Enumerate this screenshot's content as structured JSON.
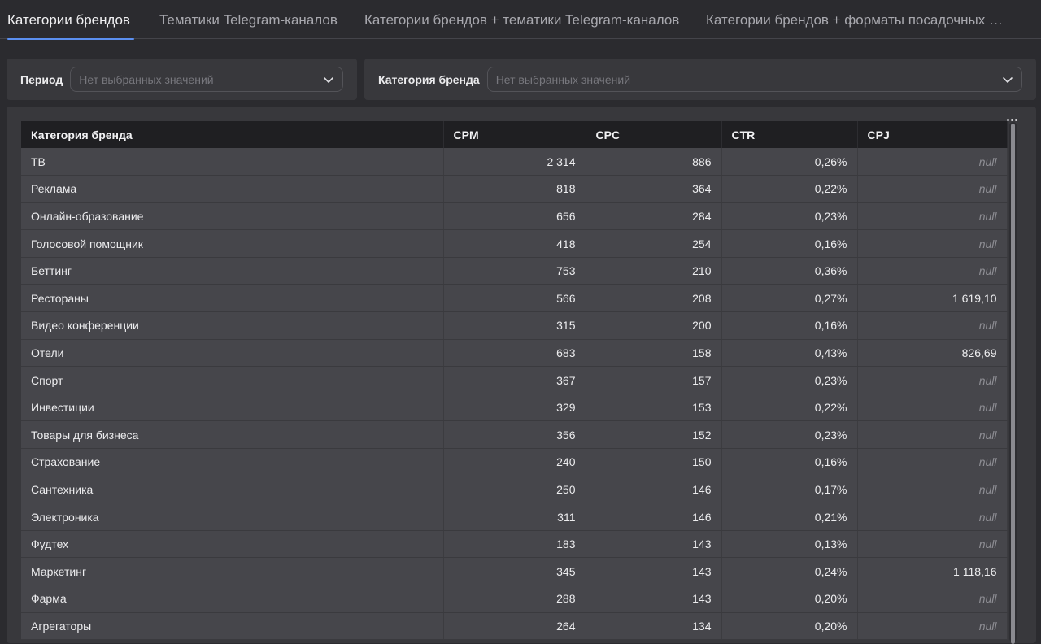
{
  "tabs": [
    {
      "label": "Категории брендов",
      "active": true
    },
    {
      "label": "Тематики Telegram-каналов",
      "active": false
    },
    {
      "label": "Категории брендов + тематики Telegram-каналов",
      "active": false
    },
    {
      "label": "Категории брендов + форматы посадочных с...",
      "active": false
    }
  ],
  "filters": {
    "period": {
      "label": "Период",
      "placeholder": "Нет выбранных значений"
    },
    "category": {
      "label": "Категория бренда",
      "placeholder": "Нет выбранных значений"
    }
  },
  "table": {
    "headers": [
      "Категория бренда",
      "CPM",
      "CPC",
      "CTR",
      "CPJ"
    ],
    "rows": [
      [
        "ТВ",
        "2 314",
        "886",
        "0,26%",
        "null"
      ],
      [
        "Реклама",
        "818",
        "364",
        "0,22%",
        "null"
      ],
      [
        "Онлайн-образование",
        "656",
        "284",
        "0,23%",
        "null"
      ],
      [
        "Голосовой помощник",
        "418",
        "254",
        "0,16%",
        "null"
      ],
      [
        "Беттинг",
        "753",
        "210",
        "0,36%",
        "null"
      ],
      [
        "Рестораны",
        "566",
        "208",
        "0,27%",
        "1 619,10"
      ],
      [
        "Видео конференции",
        "315",
        "200",
        "0,16%",
        "null"
      ],
      [
        "Отели",
        "683",
        "158",
        "0,43%",
        "826,69"
      ],
      [
        "Спорт",
        "367",
        "157",
        "0,23%",
        "null"
      ],
      [
        "Инвестиции",
        "329",
        "153",
        "0,22%",
        "null"
      ],
      [
        "Товары для бизнеса",
        "356",
        "152",
        "0,23%",
        "null"
      ],
      [
        "Страхование",
        "240",
        "150",
        "0,16%",
        "null"
      ],
      [
        "Сантехника",
        "250",
        "146",
        "0,17%",
        "null"
      ],
      [
        "Электроника",
        "311",
        "146",
        "0,21%",
        "null"
      ],
      [
        "Фудтех",
        "183",
        "143",
        "0,13%",
        "null"
      ],
      [
        "Маркетинг",
        "345",
        "143",
        "0,24%",
        "1 118,16"
      ],
      [
        "Фарма",
        "288",
        "143",
        "0,20%",
        "null"
      ],
      [
        "Агрегаторы",
        "264",
        "134",
        "0,20%",
        "null"
      ]
    ]
  },
  "icons": {
    "dropdown": "chevron-down-icon",
    "more": "more-horizontal-icon"
  },
  "colors": {
    "accent": "#5b8ff0",
    "background": "#2b2b2f",
    "panel": "#38383c",
    "header": "#1f1f22",
    "row": "#46464b"
  }
}
